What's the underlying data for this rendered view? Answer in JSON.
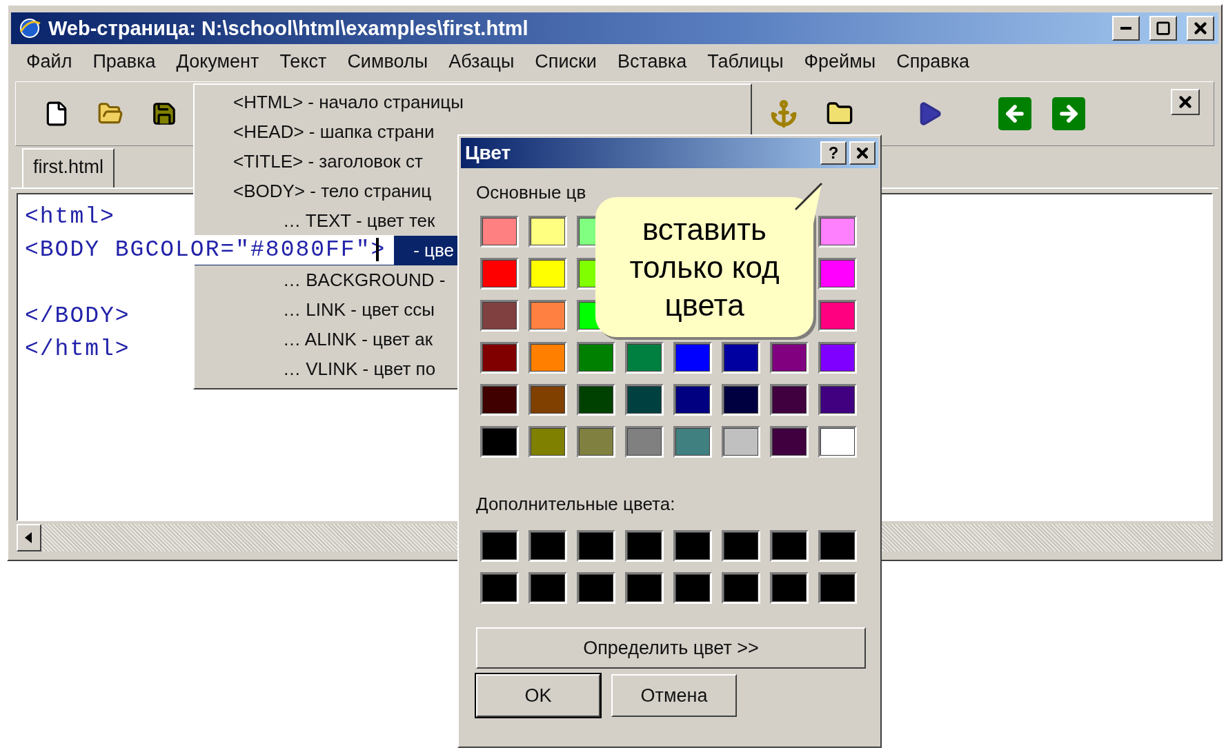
{
  "window": {
    "title": "Web-страница: N:\\school\\html\\examples\\first.html"
  },
  "menu_bar": [
    {
      "label": "Файл"
    },
    {
      "label": "Правка"
    },
    {
      "label": "Документ"
    },
    {
      "label": "Текст"
    },
    {
      "label": "Символы"
    },
    {
      "label": "Абзацы"
    },
    {
      "label": "Списки"
    },
    {
      "label": "Вставка"
    },
    {
      "label": "Таблицы"
    },
    {
      "label": "Фреймы"
    },
    {
      "label": "Справка"
    }
  ],
  "tabs": [
    {
      "label": "first.html",
      "selected": true
    }
  ],
  "editor": {
    "lines": [
      {
        "kind": "code",
        "text": "<html>",
        "highlighted": false
      },
      {
        "kind": "code",
        "text": "<BODY BGCOLOR=\"#8080FF\">",
        "highlighted": true
      },
      {
        "kind": "blank"
      },
      {
        "kind": "code",
        "text": "</BODY>",
        "highlighted": false
      },
      {
        "kind": "code",
        "text": "</html>",
        "highlighted": false
      }
    ]
  },
  "dropdown_menu": {
    "items": [
      {
        "kind": "tag",
        "label": "<HTML> - начало страницы",
        "selected": false
      },
      {
        "kind": "tag",
        "label": "<HEAD> - шапка страни",
        "selected": false
      },
      {
        "kind": "tag",
        "label": "<TITLE> - заголовок ст",
        "selected": false
      },
      {
        "kind": "tag",
        "label": "<BODY> - тело страниц",
        "selected": false
      },
      {
        "kind": "attribute",
        "label": "… TEXT - цвет тек",
        "selected": false
      },
      {
        "kind": "attribute",
        "label": "- цве",
        "selected": true
      },
      {
        "kind": "attribute",
        "label": "… BACKGROUND -",
        "selected": false
      },
      {
        "kind": "attribute",
        "label": "… LINK - цвет ссы",
        "selected": false
      },
      {
        "kind": "attribute",
        "label": "… ALINK - цвет ак",
        "selected": false
      },
      {
        "kind": "attribute",
        "label": "… VLINK - цвет по",
        "selected": false
      }
    ]
  },
  "color_dialog": {
    "title": "Цвет",
    "help_button": "?",
    "basic_colors_label": "Основные цв",
    "basic_colors": [
      {
        "color": "#ff8080"
      },
      {
        "color": "#ffff80"
      },
      {
        "color": "#80ff80"
      },
      {
        "kind": "covered"
      },
      {
        "kind": "covered"
      },
      {
        "kind": "covered"
      },
      {
        "kind": "covered"
      },
      {
        "color": "#ff80ff"
      },
      {
        "color": "#ff0000"
      },
      {
        "color": "#ffff00"
      },
      {
        "color": "#80ff00"
      },
      {
        "kind": "covered"
      },
      {
        "kind": "covered"
      },
      {
        "kind": "covered"
      },
      {
        "kind": "covered"
      },
      {
        "color": "#ff00ff"
      },
      {
        "color": "#804040"
      },
      {
        "color": "#ff8040"
      },
      {
        "color": "#00ff00"
      },
      {
        "kind": "covered"
      },
      {
        "kind": "covered"
      },
      {
        "kind": "covered"
      },
      {
        "kind": "covered"
      },
      {
        "color": "#ff0080"
      },
      {
        "color": "#800000"
      },
      {
        "color": "#ff8000"
      },
      {
        "color": "#008000"
      },
      {
        "color": "#008040"
      },
      {
        "color": "#0000ff"
      },
      {
        "color": "#0000a0"
      },
      {
        "color": "#800080"
      },
      {
        "color": "#8000ff"
      },
      {
        "color": "#400000"
      },
      {
        "color": "#804000"
      },
      {
        "color": "#004000"
      },
      {
        "color": "#004040"
      },
      {
        "color": "#000080"
      },
      {
        "color": "#000040"
      },
      {
        "color": "#400040"
      },
      {
        "color": "#400080"
      },
      {
        "color": "#000000"
      },
      {
        "color": "#808000"
      },
      {
        "color": "#808040"
      },
      {
        "color": "#808080"
      },
      {
        "color": "#408080"
      },
      {
        "color": "#c0c0c0"
      },
      {
        "color": "#400040"
      },
      {
        "color": "#ffffff"
      }
    ],
    "custom_colors_label": "Дополнительные цвета:",
    "custom_colors": [
      {
        "color": "#000000"
      },
      {
        "color": "#000000"
      },
      {
        "color": "#000000"
      },
      {
        "color": "#000000"
      },
      {
        "color": "#000000"
      },
      {
        "color": "#000000"
      },
      {
        "color": "#000000"
      },
      {
        "color": "#000000"
      },
      {
        "color": "#000000"
      },
      {
        "color": "#000000"
      },
      {
        "color": "#000000"
      },
      {
        "color": "#000000"
      },
      {
        "color": "#000000"
      },
      {
        "color": "#000000"
      },
      {
        "color": "#000000"
      },
      {
        "color": "#000000"
      }
    ],
    "define_button": "Определить цвет >>",
    "ok_button": "OK",
    "cancel_button": "Отмена"
  },
  "callout": {
    "text": "вставить только код цвета"
  }
}
